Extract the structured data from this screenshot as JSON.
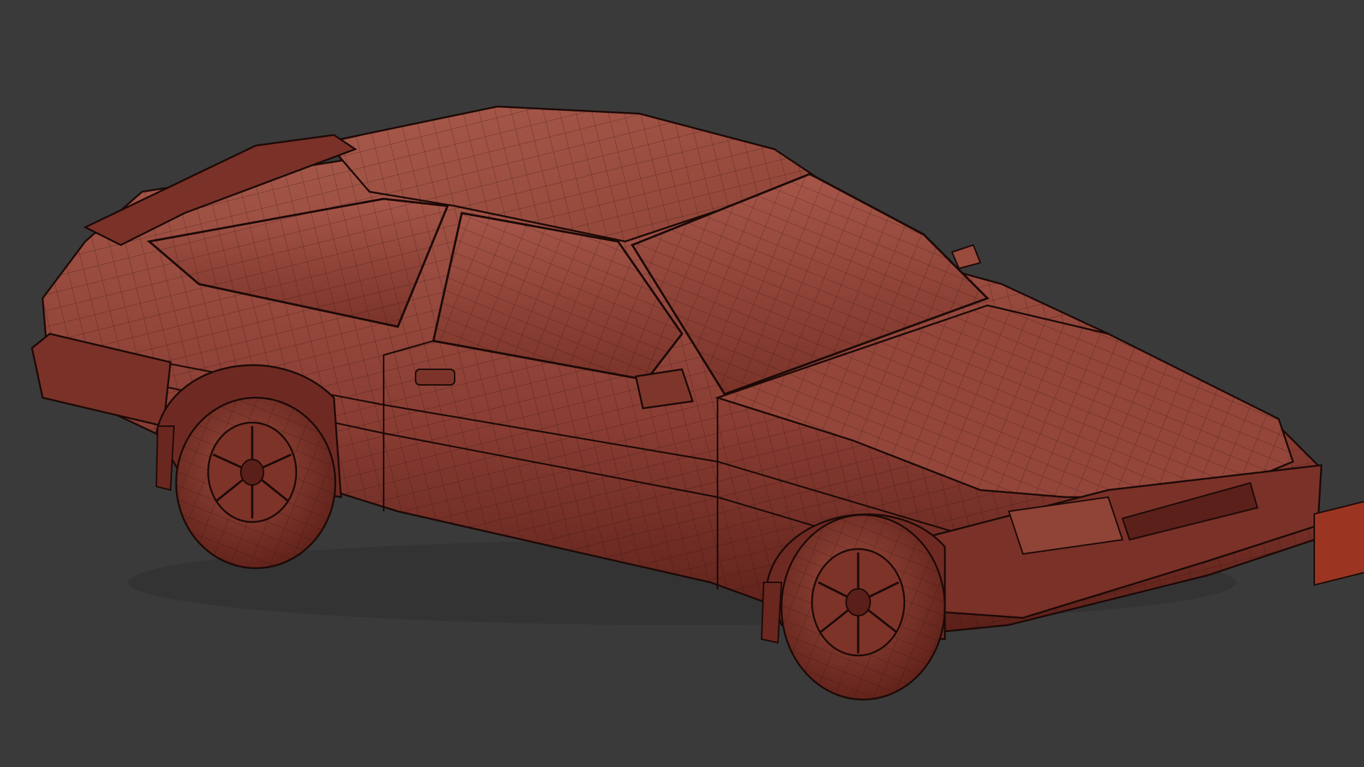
{
  "viewport": {
    "background_color": "#3a3a3a"
  },
  "model": {
    "description_shown": "",
    "shading": "clay-wireframe-overlay",
    "body_color": "#8a3d33",
    "body_highlight": "#a85a4c",
    "body_shadow": "#5c2019",
    "wire_color": "#2a0f0b",
    "plate_color": "#9b3522"
  }
}
